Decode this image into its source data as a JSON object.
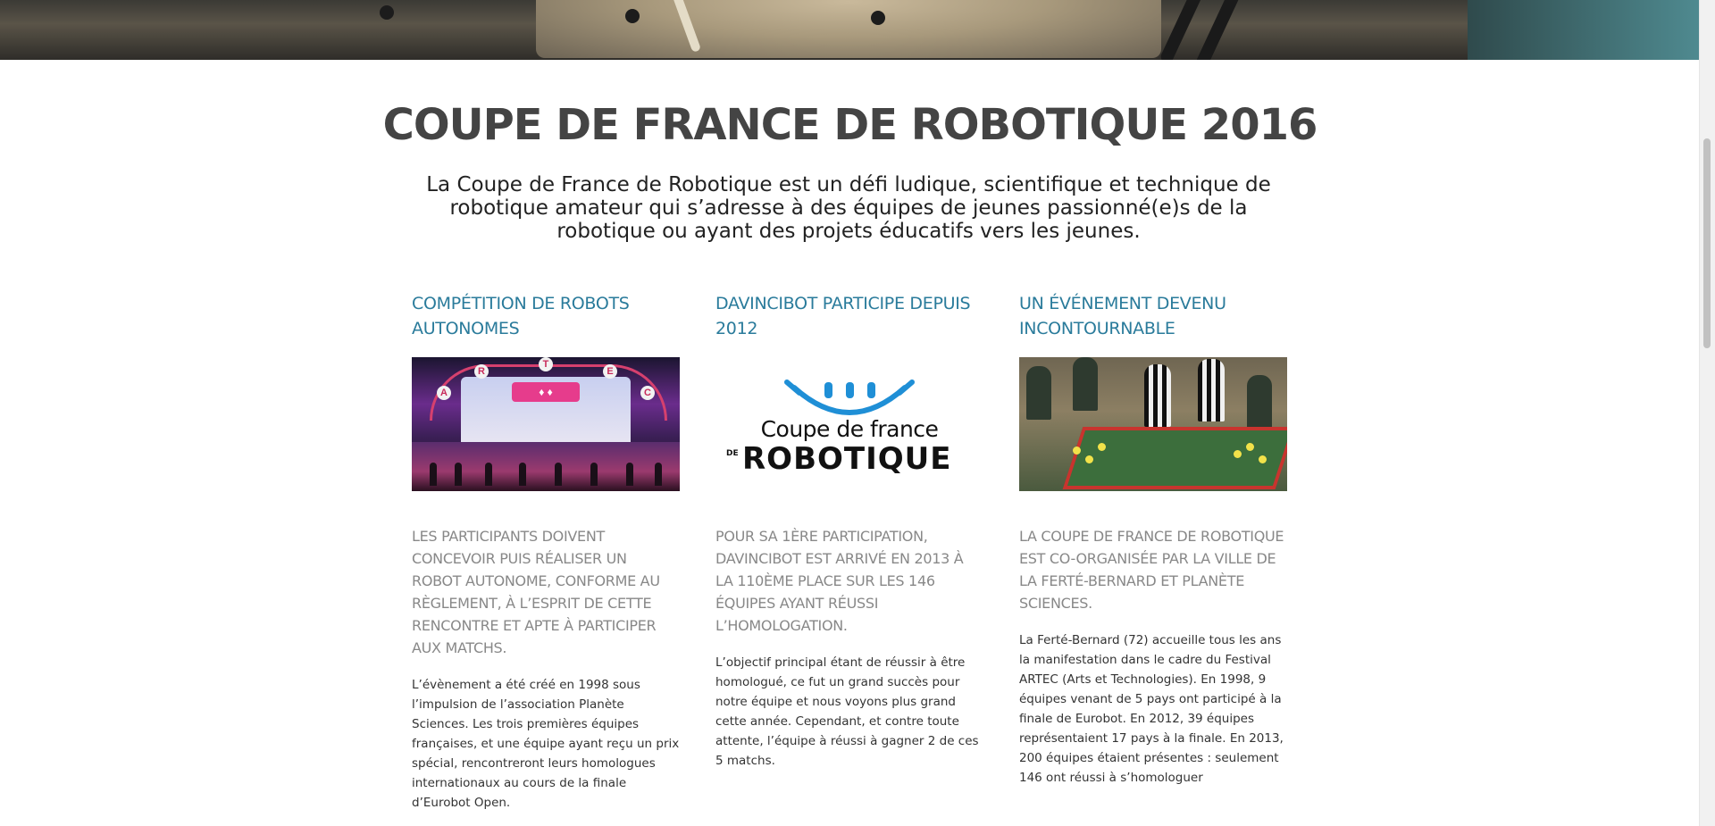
{
  "hero": {
    "icon": "hero-robot-board-photo"
  },
  "title": "COUPE DE FRANCE DE ROBOTIQUE 2016",
  "intro": "La Coupe de France de Robotique est un défi ludique, scientifique et technique de robotique amateur qui s’adresse à des équipes de jeunes passionné(e)s de la robotique ou ayant des projets éducatifs vers les jeunes.",
  "colors": {
    "heading": "#2a7b9b",
    "lead": "#888888",
    "title": "#444444"
  },
  "columns": [
    {
      "heading": "COMPÉTITION DE ROBOTS AUTONOMES",
      "image": {
        "icon": "stage-photo",
        "letters": [
          "A",
          "R",
          "T",
          "E",
          "C"
        ]
      },
      "lead": "LES PARTICIPANTS DOIVENT CONCEVOIR PUIS RÉALISER UN ROBOT AUTONOME, CONFORME AU RÈGLEMENT, À L’ESPRIT DE CETTE RENCONTRE ET APTE À PARTICIPER AUX MATCHS.",
      "body": "L’évènement a été créé en 1998 sous l’impulsion de l’association Planète Sciences. Les trois premières équipes françaises, et une équipe ayant reçu un prix spécial, rencontreront leurs homologues internationaux au cours de la finale d’Eurobot Open."
    },
    {
      "heading": "DAVINCIBOT PARTICIPE DEPUIS 2012",
      "image": {
        "icon": "coupe-de-france-logo",
        "line1": "Coupe de france",
        "line2": "ROBOTIQUE",
        "prefix": "DE"
      },
      "lead": "POUR SA 1ÈRE PARTICIPATION, DAVINCIBOT EST ARRIVÉ EN 2013 À LA 110ÈME PLACE SUR LES 146 ÉQUIPES AYANT RÉUSSI L’HOMOLOGATION.",
      "body": "L’objectif principal étant de réussir à être homologué, ce fut un grand succès pour notre équipe et nous voyons plus grand cette année. Cependant, et contre toute attente, l’équipe à réussi à gagner 2 de ces 5 matchs."
    },
    {
      "heading": "UN ÉVÉNEMENT DEVENU INCONTOURNABLE",
      "image": {
        "icon": "robot-table-photo"
      },
      "lead": "LA COUPE DE FRANCE DE ROBOTIQUE EST CO-ORGANISÉE PAR LA VILLE DE LA FERTÉ-BERNARD ET PLANÈTE SCIENCES.",
      "body": "La Ferté-Bernard (72) accueille tous les ans la manifestation dans le cadre du Festival ARTEC (Arts et Technologies). En 1998, 9 équipes venant de 5 pays ont participé à la finale de Eurobot. En 2012, 39 équipes représentaient 17 pays à la finale. En 2013, 200 équipes étaient présentes : seulement 146 ont réussi à s’homologuer"
    }
  ]
}
